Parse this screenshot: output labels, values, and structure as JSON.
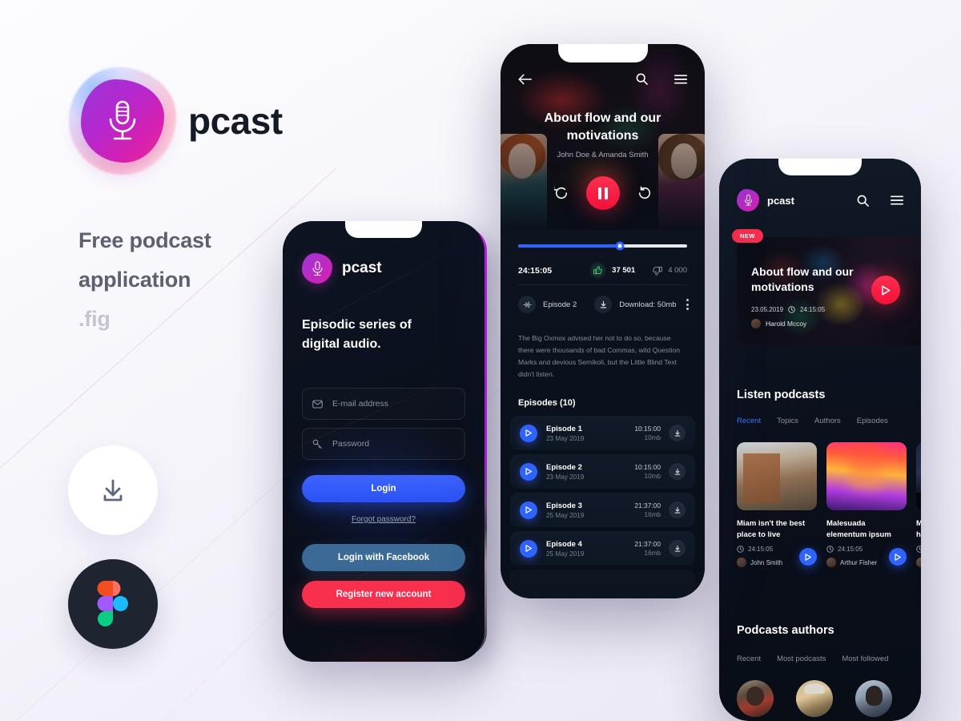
{
  "brand": {
    "name": "pcast",
    "logo_icon": "microphone-icon",
    "tagline_line1": "Free podcast",
    "tagline_line2": "application",
    "tagline_line3": ".fig"
  },
  "actions": {
    "download_icon": "download-icon",
    "figma_icon": "figma-logo-icon"
  },
  "login_screen": {
    "logo_icon": "microphone-icon",
    "app_name": "pcast",
    "subtitle": "Episodic series of\ndigital audio.",
    "subtitle_line1": "Episodic series of",
    "subtitle_line2": "digital audio.",
    "email_placeholder": "E-mail address",
    "email_value": "",
    "email_icon": "envelope-icon",
    "password_placeholder": "Password",
    "password_value": "",
    "password_icon": "key-icon",
    "login_label": "Login",
    "forgot_label": "Forgot password?",
    "facebook_label": "Login with Facebook",
    "register_label": "Register new account",
    "colors": {
      "login_button": "#3d64ff",
      "facebook_button": "#3b6a96",
      "register_button": "#f82f4d"
    }
  },
  "player_screen": {
    "back_icon": "arrow-left-icon",
    "search_icon": "search-icon",
    "menu_icon": "hamburger-menu-icon",
    "title": "About flow and our motivations",
    "title_line1": "About flow and our",
    "title_line2": "motivations",
    "authors": "John Doe & Amanda Smith",
    "rewind_icon": "rewind-15-icon",
    "pause_icon": "pause-icon",
    "forward_icon": "forward-15-icon",
    "progress_percent": 60,
    "elapsed_time": "24:15:05",
    "likes": "37 501",
    "likes_icon": "thumb-up-icon",
    "dislikes": "4 000",
    "dislikes_icon": "thumb-down-icon",
    "episode_chip": "Episode 2",
    "episode_chip_icon": "equalizer-icon",
    "download_label": "Download: 50mb",
    "download_icon": "download-icon",
    "more_icon": "kebab-menu-icon",
    "description": "The Big Oxmox advised her not to do so, because there were thousands of bad Commas, wild Question Marks and devious Semikoli, but the Little Blind Text didn't listen.",
    "episodes_heading": "Episodes (10)",
    "episodes": [
      {
        "name": "Episode 1",
        "date": "23 May 2019",
        "duration": "10:15:00",
        "size": "10mb"
      },
      {
        "name": "Episode 2",
        "date": "23 May 2019",
        "duration": "10:15:00",
        "size": "10mb"
      },
      {
        "name": "Episode 3",
        "date": "25 May 2019",
        "duration": "21:37:00",
        "size": "16mb"
      },
      {
        "name": "Episode 4",
        "date": "25 May 2019",
        "duration": "21:37:00",
        "size": "16mb"
      }
    ]
  },
  "home_screen": {
    "logo_icon": "microphone-icon",
    "app_name": "pcast",
    "search_icon": "search-icon",
    "menu_icon": "hamburger-menu-icon",
    "featured": {
      "badge": "NEW",
      "title_line1": "About flow and our",
      "title_line2": "motivations",
      "date": "23.05.2019",
      "clock_icon": "clock-icon",
      "duration": "24:15:05",
      "author": "Harold Mccoy",
      "author_avatar": "avatar",
      "play_icon": "play-icon"
    },
    "listen_section": {
      "heading": "Listen podcasts",
      "tabs": [
        "Recent",
        "Topics",
        "Authors",
        "Episodes"
      ],
      "active_tab": "Recent",
      "cards": [
        {
          "title_line1": "Miam isn't the best",
          "title_line2": "place to live",
          "duration": "24:15:05",
          "author": "John Smith"
        },
        {
          "title_line1": "Malesuada",
          "title_line2": "elementum ipsum",
          "duration": "24:15:05",
          "author": "Arthur Fisher"
        },
        {
          "title_line1": "Ma",
          "title_line2": "hal",
          "duration": "",
          "author": ""
        }
      ]
    },
    "authors_section": {
      "heading": "Podcasts authors",
      "tabs": [
        "Recent",
        "Most podcasts",
        "Most followed"
      ],
      "active_tab": "Recent",
      "avatars": [
        "avatar-1",
        "avatar-2",
        "avatar-3"
      ]
    }
  }
}
